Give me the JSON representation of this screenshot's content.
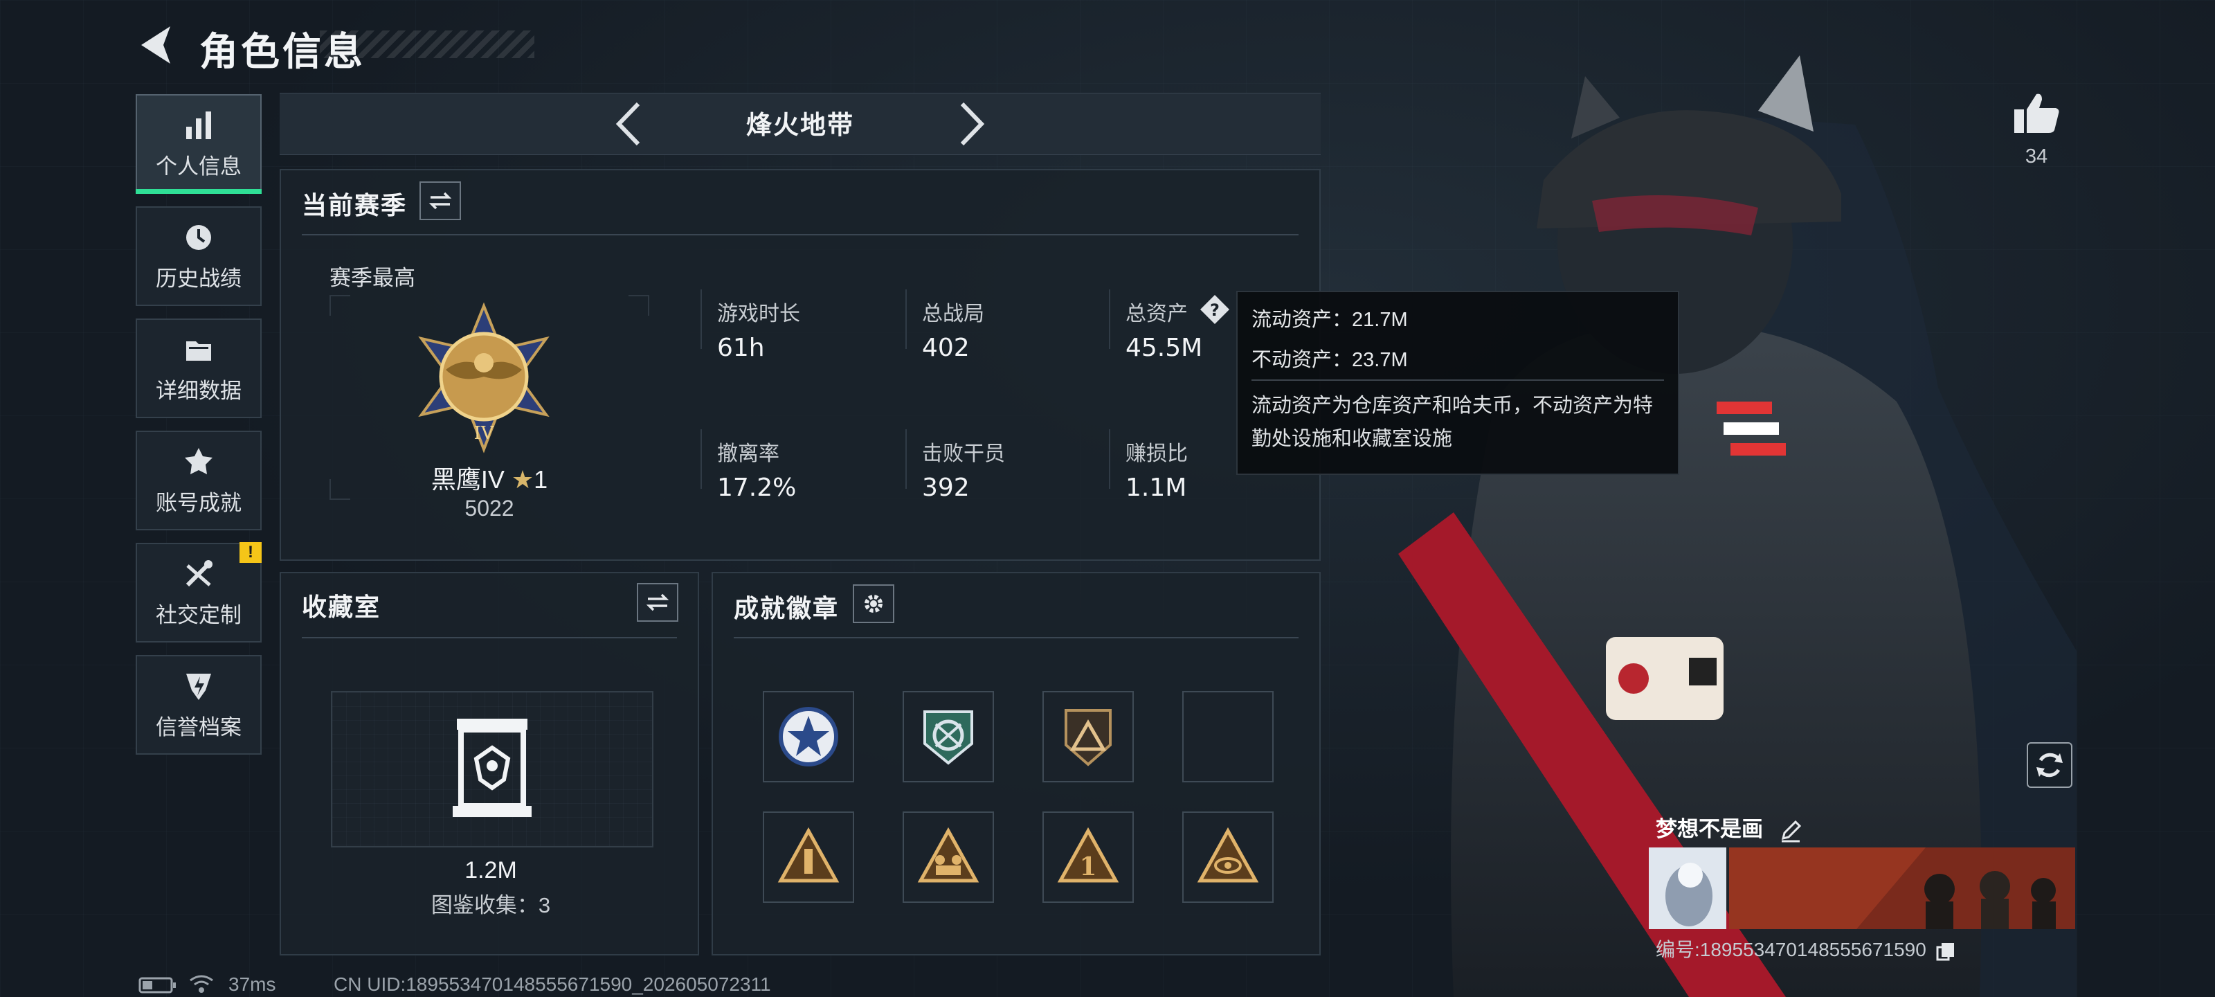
{
  "header": {
    "title": "角色信息"
  },
  "sidebar": {
    "items": [
      {
        "label": "个人信息",
        "icon": "bar-chart-icon",
        "active": true
      },
      {
        "label": "历史战绩",
        "icon": "history-clock-icon",
        "active": false
      },
      {
        "label": "详细数据",
        "icon": "folder-icon",
        "active": false
      },
      {
        "label": "账号成就",
        "icon": "achievement-medal-icon",
        "active": false
      },
      {
        "label": "社交定制",
        "icon": "tools-icon",
        "active": false,
        "badge": "!"
      },
      {
        "label": "信誉档案",
        "icon": "shield-lightning-icon",
        "active": false
      }
    ]
  },
  "mode": {
    "title": "烽火地带"
  },
  "season": {
    "title": "当前赛季",
    "best_label": "赛季最高",
    "rank_name": "黑鹰IV",
    "rank_stars": "1",
    "rank_points": "5022",
    "stats": [
      {
        "label": "游戏时长",
        "value": "61h"
      },
      {
        "label": "总战局",
        "value": "402"
      },
      {
        "label": "总资产",
        "value": "45.5M"
      },
      {
        "label": "撤离率",
        "value": "17.2%"
      },
      {
        "label": "击败干员",
        "value": "392"
      },
      {
        "label": "赚损比",
        "value": "1.1M"
      }
    ]
  },
  "tooltip": {
    "liquid": "流动资产：21.7M",
    "fixed": "不动资产：23.7M",
    "description": "流动资产为仓库资产和哈夫币，不动资产为特勤处设施和收藏室设施"
  },
  "collection": {
    "title": "收藏室",
    "value": "1.2M",
    "count_text": "图鉴收集：3"
  },
  "achievements": {
    "title": "成就徽章",
    "badges": [
      "star-emblem-badge",
      "cross-arrows-badge",
      "pyramid-shield-badge",
      "empty-slot",
      "tower-triangle-badge",
      "soldiers-triangle-badge",
      "number-one-triangle-badge",
      "eye-triangle-badge"
    ]
  },
  "player": {
    "name": "梦想不是画",
    "id_text": "编号:1895534701485556715​90",
    "likes": "34"
  },
  "status": {
    "ping": "37ms",
    "uid_text": "CN UID:1895534701485556715​90_202605072311"
  },
  "colors": {
    "accent_green": "#2fdf96",
    "warning_yellow": "#f5c518"
  }
}
